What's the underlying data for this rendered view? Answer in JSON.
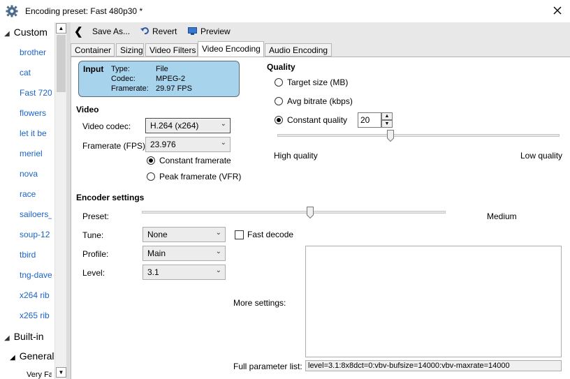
{
  "window": {
    "title": "Encoding preset: Fast 480p30 *"
  },
  "tree": {
    "custom_label": "Custom",
    "custom_items": [
      "brother",
      "cat",
      "Fast 720",
      "flowers",
      "let it be",
      "meriel",
      "nova",
      "race",
      "sailoers_",
      "soup-12",
      "tbird",
      "tng-dave",
      "x264 rib",
      "x265 rib"
    ],
    "builtin_label": "Built-in",
    "general_label": "General",
    "general_first_item": "Very Fa"
  },
  "toolbar": {
    "save_as": "Save As...",
    "revert": "Revert",
    "preview": "Preview"
  },
  "tabs": [
    "Container",
    "Sizing",
    "Video Filters",
    "Video Encoding",
    "Audio Encoding"
  ],
  "active_tab": "Video Encoding",
  "input": {
    "header": "Input",
    "type_label": "Type:",
    "type_value": "File",
    "codec_label": "Codec:",
    "codec_value": "MPEG-2",
    "framerate_label": "Framerate:",
    "framerate_value": "29.97 FPS"
  },
  "video": {
    "section": "Video",
    "codec_label": "Video codec:",
    "codec_value": "H.264 (x264)",
    "framerate_label": "Framerate (FPS):",
    "framerate_value": "23.976",
    "constant_framerate": "Constant framerate",
    "peak_framerate": "Peak framerate (VFR)",
    "selected_framerate_mode": "constant"
  },
  "quality": {
    "section": "Quality",
    "target_size": "Target size (MB)",
    "avg_bitrate": "Avg bitrate (kbps)",
    "constant_quality": "Constant quality",
    "selected_mode": "constant_quality",
    "cq_value": "20",
    "high_label": "High quality",
    "low_label": "Low quality",
    "slider_fraction": 0.4
  },
  "encoder": {
    "section": "Encoder settings",
    "preset_label": "Preset:",
    "preset_value": "Medium",
    "preset_slider_fraction": 0.555,
    "tune_label": "Tune:",
    "tune_value": "None",
    "fast_decode": "Fast decode",
    "fast_decode_checked": false,
    "profile_label": "Profile:",
    "profile_value": "Main",
    "level_label": "Level:",
    "level_value": "3.1",
    "more_settings_label": "More settings:",
    "more_settings_value": "",
    "full_param_label": "Full parameter list:",
    "full_param_value": "level=3.1:8x8dct=0:vbv-bufsize=14000:vbv-maxrate=14000"
  },
  "colors": {
    "input_box": "#a7d3ec",
    "link": "#1a63c6",
    "toolbar": "#e8e8e8"
  }
}
